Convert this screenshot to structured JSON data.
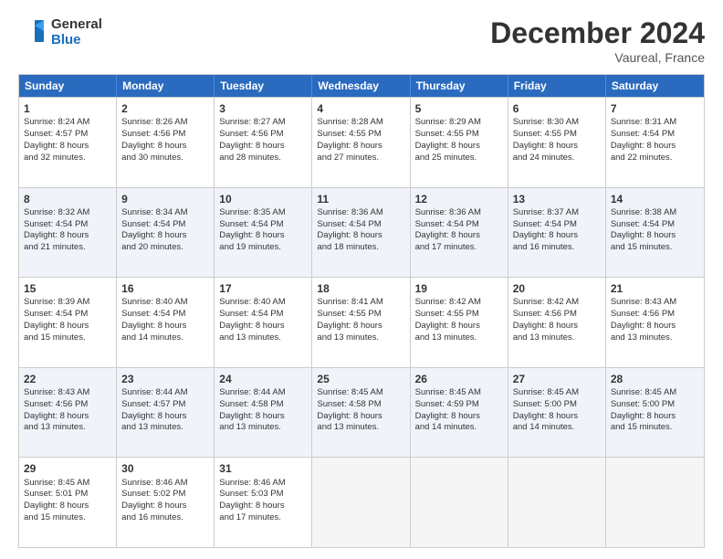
{
  "header": {
    "logo_line1": "General",
    "logo_line2": "Blue",
    "month": "December 2024",
    "location": "Vaureal, France"
  },
  "weekdays": [
    "Sunday",
    "Monday",
    "Tuesday",
    "Wednesday",
    "Thursday",
    "Friday",
    "Saturday"
  ],
  "rows": [
    [
      {
        "day": "1",
        "lines": [
          "Sunrise: 8:24 AM",
          "Sunset: 4:57 PM",
          "Daylight: 8 hours",
          "and 32 minutes."
        ]
      },
      {
        "day": "2",
        "lines": [
          "Sunrise: 8:26 AM",
          "Sunset: 4:56 PM",
          "Daylight: 8 hours",
          "and 30 minutes."
        ]
      },
      {
        "day": "3",
        "lines": [
          "Sunrise: 8:27 AM",
          "Sunset: 4:56 PM",
          "Daylight: 8 hours",
          "and 28 minutes."
        ]
      },
      {
        "day": "4",
        "lines": [
          "Sunrise: 8:28 AM",
          "Sunset: 4:55 PM",
          "Daylight: 8 hours",
          "and 27 minutes."
        ]
      },
      {
        "day": "5",
        "lines": [
          "Sunrise: 8:29 AM",
          "Sunset: 4:55 PM",
          "Daylight: 8 hours",
          "and 25 minutes."
        ]
      },
      {
        "day": "6",
        "lines": [
          "Sunrise: 8:30 AM",
          "Sunset: 4:55 PM",
          "Daylight: 8 hours",
          "and 24 minutes."
        ]
      },
      {
        "day": "7",
        "lines": [
          "Sunrise: 8:31 AM",
          "Sunset: 4:54 PM",
          "Daylight: 8 hours",
          "and 22 minutes."
        ]
      }
    ],
    [
      {
        "day": "8",
        "lines": [
          "Sunrise: 8:32 AM",
          "Sunset: 4:54 PM",
          "Daylight: 8 hours",
          "and 21 minutes."
        ]
      },
      {
        "day": "9",
        "lines": [
          "Sunrise: 8:34 AM",
          "Sunset: 4:54 PM",
          "Daylight: 8 hours",
          "and 20 minutes."
        ]
      },
      {
        "day": "10",
        "lines": [
          "Sunrise: 8:35 AM",
          "Sunset: 4:54 PM",
          "Daylight: 8 hours",
          "and 19 minutes."
        ]
      },
      {
        "day": "11",
        "lines": [
          "Sunrise: 8:36 AM",
          "Sunset: 4:54 PM",
          "Daylight: 8 hours",
          "and 18 minutes."
        ]
      },
      {
        "day": "12",
        "lines": [
          "Sunrise: 8:36 AM",
          "Sunset: 4:54 PM",
          "Daylight: 8 hours",
          "and 17 minutes."
        ]
      },
      {
        "day": "13",
        "lines": [
          "Sunrise: 8:37 AM",
          "Sunset: 4:54 PM",
          "Daylight: 8 hours",
          "and 16 minutes."
        ]
      },
      {
        "day": "14",
        "lines": [
          "Sunrise: 8:38 AM",
          "Sunset: 4:54 PM",
          "Daylight: 8 hours",
          "and 15 minutes."
        ]
      }
    ],
    [
      {
        "day": "15",
        "lines": [
          "Sunrise: 8:39 AM",
          "Sunset: 4:54 PM",
          "Daylight: 8 hours",
          "and 15 minutes."
        ]
      },
      {
        "day": "16",
        "lines": [
          "Sunrise: 8:40 AM",
          "Sunset: 4:54 PM",
          "Daylight: 8 hours",
          "and 14 minutes."
        ]
      },
      {
        "day": "17",
        "lines": [
          "Sunrise: 8:40 AM",
          "Sunset: 4:54 PM",
          "Daylight: 8 hours",
          "and 13 minutes."
        ]
      },
      {
        "day": "18",
        "lines": [
          "Sunrise: 8:41 AM",
          "Sunset: 4:55 PM",
          "Daylight: 8 hours",
          "and 13 minutes."
        ]
      },
      {
        "day": "19",
        "lines": [
          "Sunrise: 8:42 AM",
          "Sunset: 4:55 PM",
          "Daylight: 8 hours",
          "and 13 minutes."
        ]
      },
      {
        "day": "20",
        "lines": [
          "Sunrise: 8:42 AM",
          "Sunset: 4:56 PM",
          "Daylight: 8 hours",
          "and 13 minutes."
        ]
      },
      {
        "day": "21",
        "lines": [
          "Sunrise: 8:43 AM",
          "Sunset: 4:56 PM",
          "Daylight: 8 hours",
          "and 13 minutes."
        ]
      }
    ],
    [
      {
        "day": "22",
        "lines": [
          "Sunrise: 8:43 AM",
          "Sunset: 4:56 PM",
          "Daylight: 8 hours",
          "and 13 minutes."
        ]
      },
      {
        "day": "23",
        "lines": [
          "Sunrise: 8:44 AM",
          "Sunset: 4:57 PM",
          "Daylight: 8 hours",
          "and 13 minutes."
        ]
      },
      {
        "day": "24",
        "lines": [
          "Sunrise: 8:44 AM",
          "Sunset: 4:58 PM",
          "Daylight: 8 hours",
          "and 13 minutes."
        ]
      },
      {
        "day": "25",
        "lines": [
          "Sunrise: 8:45 AM",
          "Sunset: 4:58 PM",
          "Daylight: 8 hours",
          "and 13 minutes."
        ]
      },
      {
        "day": "26",
        "lines": [
          "Sunrise: 8:45 AM",
          "Sunset: 4:59 PM",
          "Daylight: 8 hours",
          "and 14 minutes."
        ]
      },
      {
        "day": "27",
        "lines": [
          "Sunrise: 8:45 AM",
          "Sunset: 5:00 PM",
          "Daylight: 8 hours",
          "and 14 minutes."
        ]
      },
      {
        "day": "28",
        "lines": [
          "Sunrise: 8:45 AM",
          "Sunset: 5:00 PM",
          "Daylight: 8 hours",
          "and 15 minutes."
        ]
      }
    ],
    [
      {
        "day": "29",
        "lines": [
          "Sunrise: 8:45 AM",
          "Sunset: 5:01 PM",
          "Daylight: 8 hours",
          "and 15 minutes."
        ]
      },
      {
        "day": "30",
        "lines": [
          "Sunrise: 8:46 AM",
          "Sunset: 5:02 PM",
          "Daylight: 8 hours",
          "and 16 minutes."
        ]
      },
      {
        "day": "31",
        "lines": [
          "Sunrise: 8:46 AM",
          "Sunset: 5:03 PM",
          "Daylight: 8 hours",
          "and 17 minutes."
        ]
      },
      {
        "day": "",
        "lines": []
      },
      {
        "day": "",
        "lines": []
      },
      {
        "day": "",
        "lines": []
      },
      {
        "day": "",
        "lines": []
      }
    ]
  ]
}
